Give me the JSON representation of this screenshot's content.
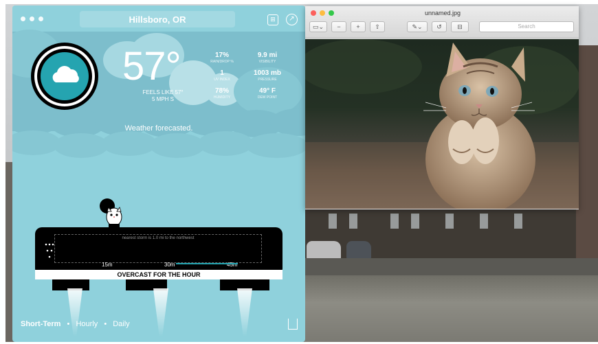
{
  "weather_app": {
    "location": "Hillsboro, OR",
    "temperature": "57°",
    "feels_like": "FEELS LIKE 57°",
    "wind": "5 MPH S",
    "stats": [
      {
        "value": "17%",
        "label": "RAIN/DROP %"
      },
      {
        "value": "9.9 mi",
        "label": "VISIBILITY"
      },
      {
        "value": "1",
        "label": "UV INDEX"
      },
      {
        "value": "1003 mb",
        "label": "PRESSURE"
      },
      {
        "value": "78%",
        "label": "HUMIDITY"
      },
      {
        "value": "49° F",
        "label": "DEW POINT"
      }
    ],
    "summary": "Weather forecasted.",
    "storm_note": "nearest storm is 1.0 mi to the northwest",
    "ticks": [
      "15m",
      "30m",
      "45m"
    ],
    "hour_summary": "OVERCAST FOR THE HOUR",
    "footer": {
      "short_term": "Short-Term",
      "hourly": "Hourly",
      "daily": "Daily"
    },
    "accent_color": "#25a4b0"
  },
  "preview_window": {
    "title": "unnamed.jpg",
    "search_placeholder": "Search"
  }
}
